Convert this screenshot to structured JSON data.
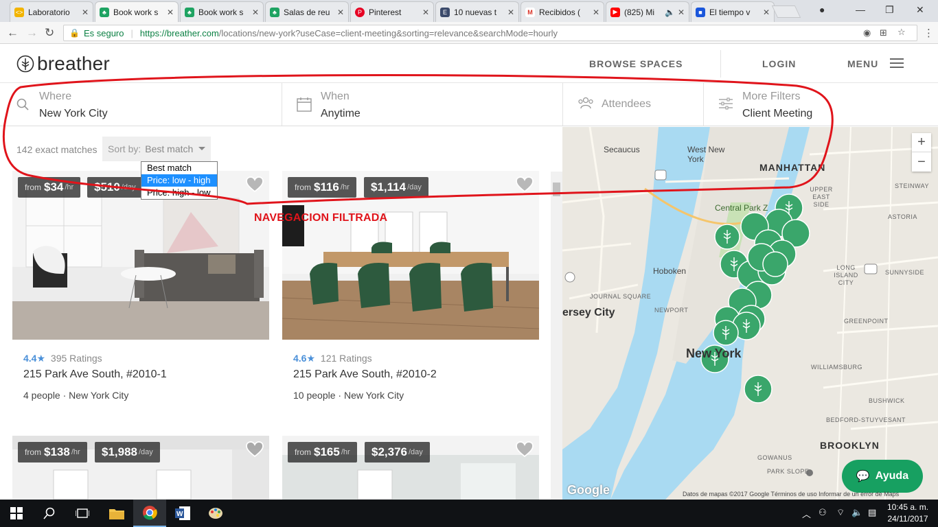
{
  "browser": {
    "tabs": [
      {
        "title": "Laboratorio",
        "color": "#f2b400",
        "glyph": "<>"
      },
      {
        "title": "Book work s",
        "color": "#1ea362",
        "glyph": "♣"
      },
      {
        "title": "Book work s",
        "color": "#1ea362",
        "glyph": "♣"
      },
      {
        "title": "Salas de reu",
        "color": "#1ea362",
        "glyph": "♣"
      },
      {
        "title": "Pinterest",
        "color": "#e60023",
        "glyph": "P"
      },
      {
        "title": "10 nuevas t",
        "color": "#3b4a6b",
        "glyph": "E"
      },
      {
        "title": "Recibidos (",
        "color": "#d93025",
        "glyph": "M"
      },
      {
        "title": "(825) Mi",
        "color": "#ff0000",
        "glyph": "▶"
      },
      {
        "title": "El tiempo v",
        "color": "#1a56db",
        "glyph": "■"
      }
    ],
    "secure_label": "Es seguro",
    "url_host": "https://breather.com",
    "url_path": "/locations/new-york?useCase=client-meeting&sorting=relevance&searchMode=hourly"
  },
  "header": {
    "logo_text": "breather",
    "browse_spaces": "BROWSE SPACES",
    "login": "LOGIN",
    "menu": "MENU"
  },
  "filters": {
    "where_label": "Where",
    "where_value": "New York City",
    "when_label": "When",
    "when_value": "Anytime",
    "attendees_label": "Attendees",
    "more_label": "More Filters",
    "more_value": "Client Meeting"
  },
  "results": {
    "count": "142 exact matches",
    "sort_label": "Sort by:",
    "sort_value": "Best match",
    "sort_options": [
      "Best match",
      "Price: low - high",
      "Price: high - low"
    ],
    "cards": [
      {
        "from": "from",
        "hourly": "$34",
        "hr_unit": "/hr",
        "daily": "$510",
        "day_unit": "/day",
        "rating": "4.4",
        "ratings_count": "395 Ratings",
        "address": "215 Park Ave South, #2010-1",
        "people": "4 people",
        "city": "New York City"
      },
      {
        "from": "from",
        "hourly": "$116",
        "hr_unit": "/hr",
        "daily": "$1,114",
        "day_unit": "/day",
        "rating": "4.6",
        "ratings_count": "121 Ratings",
        "address": "215 Park Ave South, #2010-2",
        "people": "10 people",
        "city": "New York City"
      },
      {
        "from": "from",
        "hourly": "$138",
        "hr_unit": "/hr",
        "daily": "$1,988",
        "day_unit": "/day"
      },
      {
        "from": "from",
        "hourly": "$165",
        "hr_unit": "/hr",
        "daily": "$2,376",
        "day_unit": "/day"
      }
    ]
  },
  "annotation": "NAVEGACION FILTRADA",
  "map": {
    "labels": {
      "secaucus": "Secaucus",
      "west_new_york": "West New York",
      "manhattan": "MANHATTAN",
      "central_park": "Central Park Z",
      "hoboken": "Hoboken",
      "jersey_city": "ersey City",
      "new_york": "New York",
      "brooklyn": "BROOKLYN",
      "astoria": "ASTORIA",
      "long_island_city": "LONG ISLAND CITY",
      "upper_east_side": "UPPER EAST SIDE",
      "steinway": "STEINWAY",
      "greenpoint": "GREENPOINT",
      "williamsburg": "WILLIAMSBURG",
      "bushwick": "BUSHWICK",
      "bed_stuy": "BEDFORD-STUYVESANT",
      "park_slope": "PARK SLOPE",
      "gowanus": "GOWANUS",
      "journal_square": "JOURNAL SQUARE",
      "newport": "NEWPORT",
      "sunnyside": "SUNNYSIDE"
    },
    "zoom_in": "+",
    "zoom_out": "−",
    "google": "Google",
    "footer": "Datos de mapas ©2017 Google    Términos de uso    Informar de un error de Maps",
    "help": "Ayuda"
  },
  "taskbar": {
    "time": "10:45 a. m.",
    "date": "24/11/2017"
  }
}
